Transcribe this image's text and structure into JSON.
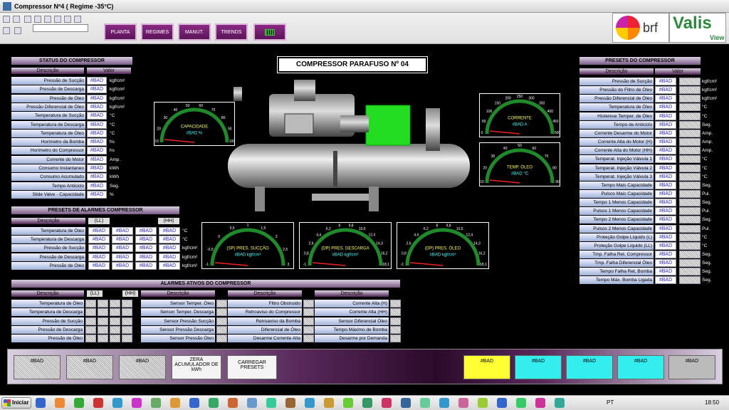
{
  "window": {
    "title": "Compressor Nº4 ( Regime -35°C)"
  },
  "nav": {
    "planta": "PLANTA",
    "regimes": "REGIMES",
    "manut": "MANUT.",
    "trends": "TRENDS"
  },
  "logos": {
    "brf": "brf",
    "valis": "Valis",
    "view": "View"
  },
  "main_title": "COMPRESSOR PARAFUSO Nº 04",
  "status": {
    "title": "STATUS DO COMPRESSOR",
    "col_desc": "Descrição",
    "col_val": "Valor",
    "rows": [
      {
        "label": "Pressão de Sucção",
        "value": "#BAD",
        "unit": "kgf/cm²"
      },
      {
        "label": "Pressão de Descarga",
        "value": "#BAD",
        "unit": "kgf/cm²"
      },
      {
        "label": "Pressão de Óleo",
        "value": "#BAD",
        "unit": "kgf/cm²"
      },
      {
        "label": "Pressão Diferencial de Óleo",
        "value": "#BAD",
        "unit": "kgf/cm²"
      },
      {
        "label": "Temperatura de Sucção",
        "value": "#BAD",
        "unit": "°C"
      },
      {
        "label": "Temperatura de Descarga",
        "value": "#BAD",
        "unit": "°C"
      },
      {
        "label": "Temperatura de Óleo",
        "value": "#BAD",
        "unit": "°C"
      },
      {
        "label": "Horímetro da Bomba",
        "value": "#BAD",
        "unit": "hs"
      },
      {
        "label": "Horímetro do Compressor",
        "value": "#BAD",
        "unit": "hs"
      },
      {
        "label": "Corrente do Motor",
        "value": "#BAD",
        "unit": "Amp."
      },
      {
        "label": "Consumo Instantaneo",
        "value": "#BAD",
        "unit": "kWh"
      },
      {
        "label": "Consumo Acumulado",
        "value": "#BAD",
        "unit": "kWh"
      },
      {
        "label": "Tempo Anticiclo",
        "value": "#BAD",
        "unit": "Seg."
      },
      {
        "label": "Slide Valve - Capacidade",
        "value": "#BAD",
        "unit": "%"
      }
    ]
  },
  "presets_alarm": {
    "title": "PRESETS DE ALARMES COMPRESSOR",
    "col_desc": "Descrição",
    "ll": "(LL)",
    "hh": "(HH)",
    "rows": [
      {
        "label": "Temperatura de Óleo",
        "vals": [
          "#BAD",
          "#BAD",
          "#BAD",
          "#BAD"
        ],
        "unit": "°C"
      },
      {
        "label": "Temperatura de Descarga",
        "vals": [
          "#BAD",
          "#BAD",
          "#BAD",
          "#BAD"
        ],
        "unit": "°C"
      },
      {
        "label": "Pressão de Sucção",
        "vals": [
          "#BAD",
          "#BAD",
          "#BAD",
          "#BAD"
        ],
        "unit": "kgf/cm²"
      },
      {
        "label": "Pressão de Descarga",
        "vals": [
          "#BAD",
          "#BAD",
          "#BAD",
          "#BAD"
        ],
        "unit": "kgf/cm²"
      },
      {
        "label": "Pressão de Óleo",
        "vals": [
          "#BAD",
          "#BAD",
          "#BAD",
          "#BAD"
        ],
        "unit": "kgf/cm²"
      }
    ]
  },
  "alarms": {
    "title": "ALARMES ATIVOS DO COMPRESSOR",
    "col_desc": "Descrição",
    "ll": "(LL)",
    "hh": "(HH)",
    "c1": [
      "Temperatura de Óleo",
      "Temperatura de Descarga",
      "Pressão de Sucção",
      "Pressão de Descarga",
      "Pressão de Óleo"
    ],
    "c2": [
      "Sensor Temper. Óleo",
      "Sensor Temper. Descarga",
      "Sensor Pressão Sucção",
      "Sensor Pressão Descarga",
      "Sensor Pressão Óleo"
    ],
    "c3": [
      "Filtro Obstruido",
      "Retroaviso do Compressor",
      "Retroaviso da Bomba",
      "Diferencial de Óleo",
      "Desarme Corrente Alta"
    ],
    "c4": [
      "Corrente Alta (H)",
      "Corrente Alta (HH)",
      "Sensor Diferencial Óleo",
      "Tempo Máximo de Bomba",
      "Desarme por Demanda"
    ]
  },
  "presets": {
    "title": "PRESETS DO COMPRESSOR",
    "col_desc": "Descrição",
    "col_val": "Valor",
    "rows": [
      {
        "label": "Pressão de Sucção",
        "value": "#BAD",
        "unit": "kgf/cm²"
      },
      {
        "label": "Pressão do Filtro de Óleo",
        "value": "#BAD",
        "unit": "kgf/cm²"
      },
      {
        "label": "Pressão Diferencial de Óleo",
        "value": "#BAD",
        "unit": "kgf/cm²"
      },
      {
        "label": "Temperatura de Óleo",
        "value": "#BAD",
        "unit": "°C"
      },
      {
        "label": "Histerese Temper. de Óleo",
        "value": "#BAD",
        "unit": "°C"
      },
      {
        "label": "Tempo de Anticiclo",
        "value": "#BAD",
        "unit": "Seg."
      },
      {
        "label": "Corrente Desarme do Motor",
        "value": "#BAD",
        "unit": "Amp."
      },
      {
        "label": "Corrente Alta do Motor (H)",
        "value": "#BAD",
        "unit": "Amp."
      },
      {
        "label": "Corrente Alta do Motor (HH)",
        "value": "#BAD",
        "unit": "Amp."
      },
      {
        "label": "Temperat. Injeção Válvula 1",
        "value": "#BAD",
        "unit": "°C"
      },
      {
        "label": "Temperat. Injeção Válvula 2",
        "value": "#BAD",
        "unit": "°C"
      },
      {
        "label": "Temperat. Injeção Válvula 3",
        "value": "#BAD",
        "unit": "°C"
      },
      {
        "label": "Tempo Mais Capacidade",
        "value": "#BAD",
        "unit": "Seg."
      },
      {
        "label": "Pulsos Mais Capacidade",
        "value": "#BAD",
        "unit": "Pul."
      },
      {
        "label": "Tempo 1 Menos Capacidade",
        "value": "#BAD",
        "unit": "Seg."
      },
      {
        "label": "Pulsos 1 Menos Capacidade",
        "value": "#BAD",
        "unit": "Pul."
      },
      {
        "label": "Tempo 2 Menos Capacidade",
        "value": "#BAD",
        "unit": "Seg."
      },
      {
        "label": "Pulsos 2 Menos Capacidade",
        "value": "#BAD",
        "unit": "Pul."
      },
      {
        "label": "Proteção Golpe Líquido (L)",
        "value": "#BAD",
        "unit": "°C"
      },
      {
        "label": "Proteção Golpe Líquido (LL)",
        "value": "#BAD",
        "unit": "°C"
      },
      {
        "label": "Tmp. Falha Ret. Compressor",
        "value": "#BAD",
        "unit": "Seg."
      },
      {
        "label": "Tmp. Falha Diferencial Óleo",
        "value": "#BAD",
        "unit": "Seg."
      },
      {
        "label": "Tempo Falha Ret. Bomba",
        "value": "#BAD",
        "unit": "Seg."
      },
      {
        "label": "Tempo Máx. Bomba Ligada",
        "value": "#BAD",
        "unit": "Seg."
      }
    ]
  },
  "gauges": {
    "capacidade": {
      "title": "CAPACIDADE",
      "value": "#BAD",
      "unit": "%",
      "ticks": [
        "10",
        "20",
        "30",
        "40",
        "50",
        "60",
        "70",
        "80",
        "90",
        "100"
      ]
    },
    "corrente": {
      "title": "CORRENTE",
      "value": "#BAD",
      "unit": "A",
      "ticks": [
        "0",
        "50",
        "100",
        "150",
        "200",
        "250",
        "300",
        "350",
        "400",
        "450",
        "500"
      ]
    },
    "temp_oleo": {
      "title": "TEMP. ÓLEO",
      "value": "#BAD",
      "unit": "°C",
      "ticks": [
        "10",
        "20",
        "30",
        "40",
        "50",
        "60",
        "70",
        "80",
        "90"
      ]
    },
    "succao": {
      "title": "(SP) PRES. SUCÇÃO",
      "value": "#BAD",
      "unit": "kgf/cm²",
      "ticks": [
        "-1",
        "-0,5",
        "0",
        "0,5",
        "1",
        "1,5",
        "2",
        "2,5",
        "3"
      ]
    },
    "descarga": {
      "title": "(DP) PRES. DESCARGA",
      "value": "#BAD",
      "unit": "kgf/cm²",
      "ticks": [
        "-1",
        "0,8",
        "2,6",
        "4,4",
        "6,2",
        "8",
        "9,8",
        "10,5",
        "12,4",
        "14,3",
        "16,2",
        "18,1"
      ]
    },
    "oleo": {
      "title": "(DP) PRES. ÓLEO",
      "value": "#BAD",
      "unit": "kgf/cm²",
      "ticks": [
        "-1",
        "0,8",
        "2,6",
        "4,4",
        "6,2",
        "8",
        "9,8",
        "10,5",
        "12,4",
        "14,3",
        "16,2",
        "18,1"
      ]
    }
  },
  "bottom": {
    "b1": "#BAD",
    "b2": "#BAD",
    "b3": "#BAD",
    "zera": "ZERA ACUMULADOR DE kWh",
    "carregar": "CARREGAR PRESETS",
    "s1": "#BAD",
    "s2": "#BAD",
    "s3": "#BAD",
    "s4": "#BAD",
    "s5": "#BAD"
  },
  "taskbar": {
    "start": "Iniciar",
    "lang": "PT",
    "time": "18:50"
  },
  "colors": {
    "panel_bg": "#000000",
    "button_purple": "#7a1f76",
    "gauge_green": "#1f8a2a",
    "status_yellow": "#ffff33",
    "status_cyan": "#33eeee"
  }
}
